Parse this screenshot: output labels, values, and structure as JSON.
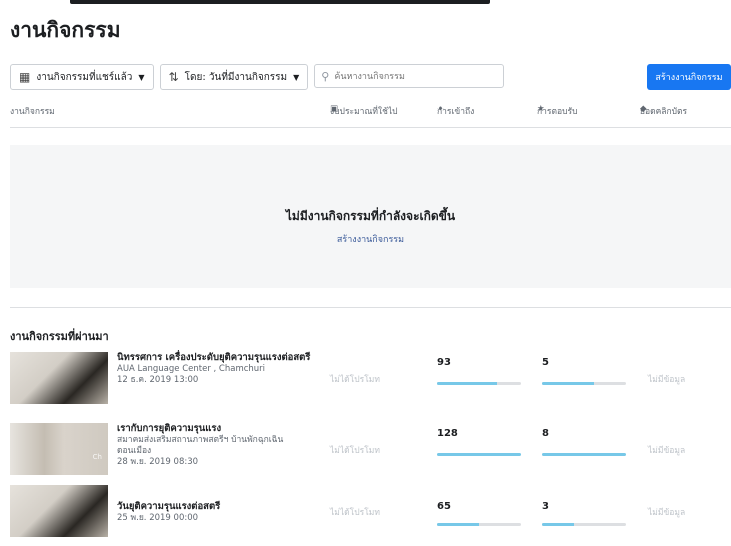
{
  "page_title": "งานกิจกรรม",
  "toolbar": {
    "filter_label": "งานกิจกรรมที่แชร์แล้ว",
    "sort_label": "โดย: วันที่มีงานกิจกรรม",
    "search_placeholder": "ค้นหางานกิจกรรม",
    "create_label": "สร้างงานกิจกรรม"
  },
  "columns": {
    "event": "งานกิจกรรม",
    "budget": "งบประมาณที่ใช้ไป",
    "reach": "การเข้าถึง",
    "responses": "การตอบรับ",
    "ticket_clicks": "ยอดคลิกบัตร"
  },
  "empty_state": {
    "message": "ไม่มีงานกิจกรรมที่กำลังจะเกิดขึ้น",
    "link": "สร้างงานกิจกรรม"
  },
  "past": {
    "title": "งานกิจกรรมที่ผ่านมา",
    "rows": [
      {
        "name": "นิทรรศการ เครื่องประดับยุติความรุนแรงต่อสตรี",
        "location": "AUA Language Center , Chamchuri",
        "date": "12 ธ.ค. 2019 13:00",
        "budget": "ไม่ได้โปรโมท",
        "reach": "93",
        "reach_fill": 0.72,
        "responses": "5",
        "responses_fill": 0.62,
        "clicks": "ไม่มีข้อมูล"
      },
      {
        "name": "เรากับการยุติความรุนแรง",
        "location": "สมาคมส่งเสริมสถานภาพสตรีฯ บ้านพักฉุกเฉิน ดอนเมือง",
        "date": "28 พ.ย. 2019 08:30",
        "budget": "ไม่ได้โปรโมท",
        "reach": "128",
        "reach_fill": 1.0,
        "responses": "8",
        "responses_fill": 1.0,
        "clicks": "ไม่มีข้อมูล"
      },
      {
        "name": "วันยุติความรุนแรงต่อสตรี",
        "location": "",
        "date": "25 พ.ย. 2019 00:00",
        "budget": "ไม่ได้โปรโมท",
        "reach": "65",
        "reach_fill": 0.5,
        "responses": "3",
        "responses_fill": 0.38,
        "clicks": "ไม่มีข้อมูล"
      }
    ]
  },
  "accent_color": "#1877f2",
  "bar_color": "#77c8e8"
}
